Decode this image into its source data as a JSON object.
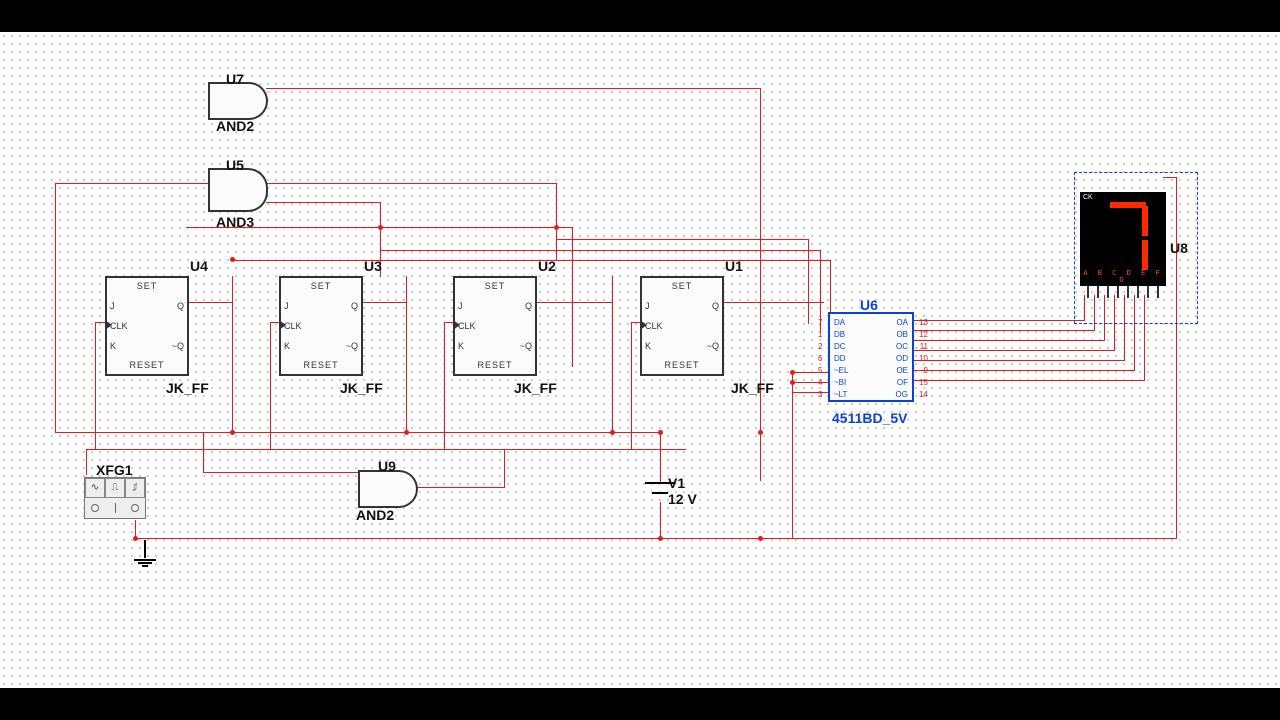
{
  "gates": {
    "u7": {
      "ref": "U7",
      "type": "AND2"
    },
    "u5": {
      "ref": "U5",
      "type": "AND3"
    },
    "u9": {
      "ref": "U9",
      "type": "AND2"
    }
  },
  "flipflops": {
    "u4": {
      "ref": "U4",
      "type": "JK_FF"
    },
    "u3": {
      "ref": "U3",
      "type": "JK_FF"
    },
    "u2": {
      "ref": "U2",
      "type": "JK_FF"
    },
    "u1": {
      "ref": "U1",
      "type": "JK_FF"
    },
    "pins": {
      "set": "SET",
      "reset": "RESET",
      "j": "J",
      "k": "K",
      "clk": "CLK",
      "q": "Q",
      "nq": "~Q"
    }
  },
  "decoder": {
    "ref": "U6",
    "type": "4511BD_5V",
    "left_pins": [
      {
        "lab": "DA",
        "n": "7"
      },
      {
        "lab": "DB",
        "n": "1"
      },
      {
        "lab": "DC",
        "n": "2"
      },
      {
        "lab": "DD",
        "n": "6"
      },
      {
        "lab": "~EL",
        "n": "5"
      },
      {
        "lab": "~BI",
        "n": "4"
      },
      {
        "lab": "~LT",
        "n": "3"
      }
    ],
    "right_pins": [
      {
        "lab": "OA",
        "n": "13"
      },
      {
        "lab": "OB",
        "n": "12"
      },
      {
        "lab": "OC",
        "n": "11"
      },
      {
        "lab": "OD",
        "n": "10"
      },
      {
        "lab": "OE",
        "n": "9"
      },
      {
        "lab": "OF",
        "n": "15"
      },
      {
        "lab": "OG",
        "n": "14"
      }
    ]
  },
  "display": {
    "ref": "U8",
    "ck": "CK",
    "letters": "A B C D E F G",
    "digit": "7"
  },
  "source": {
    "ref": "V1",
    "value": "12 V"
  },
  "funcgen": {
    "ref": "XFG1",
    "modes": [
      "∿",
      "⎍",
      "⎎"
    ]
  }
}
